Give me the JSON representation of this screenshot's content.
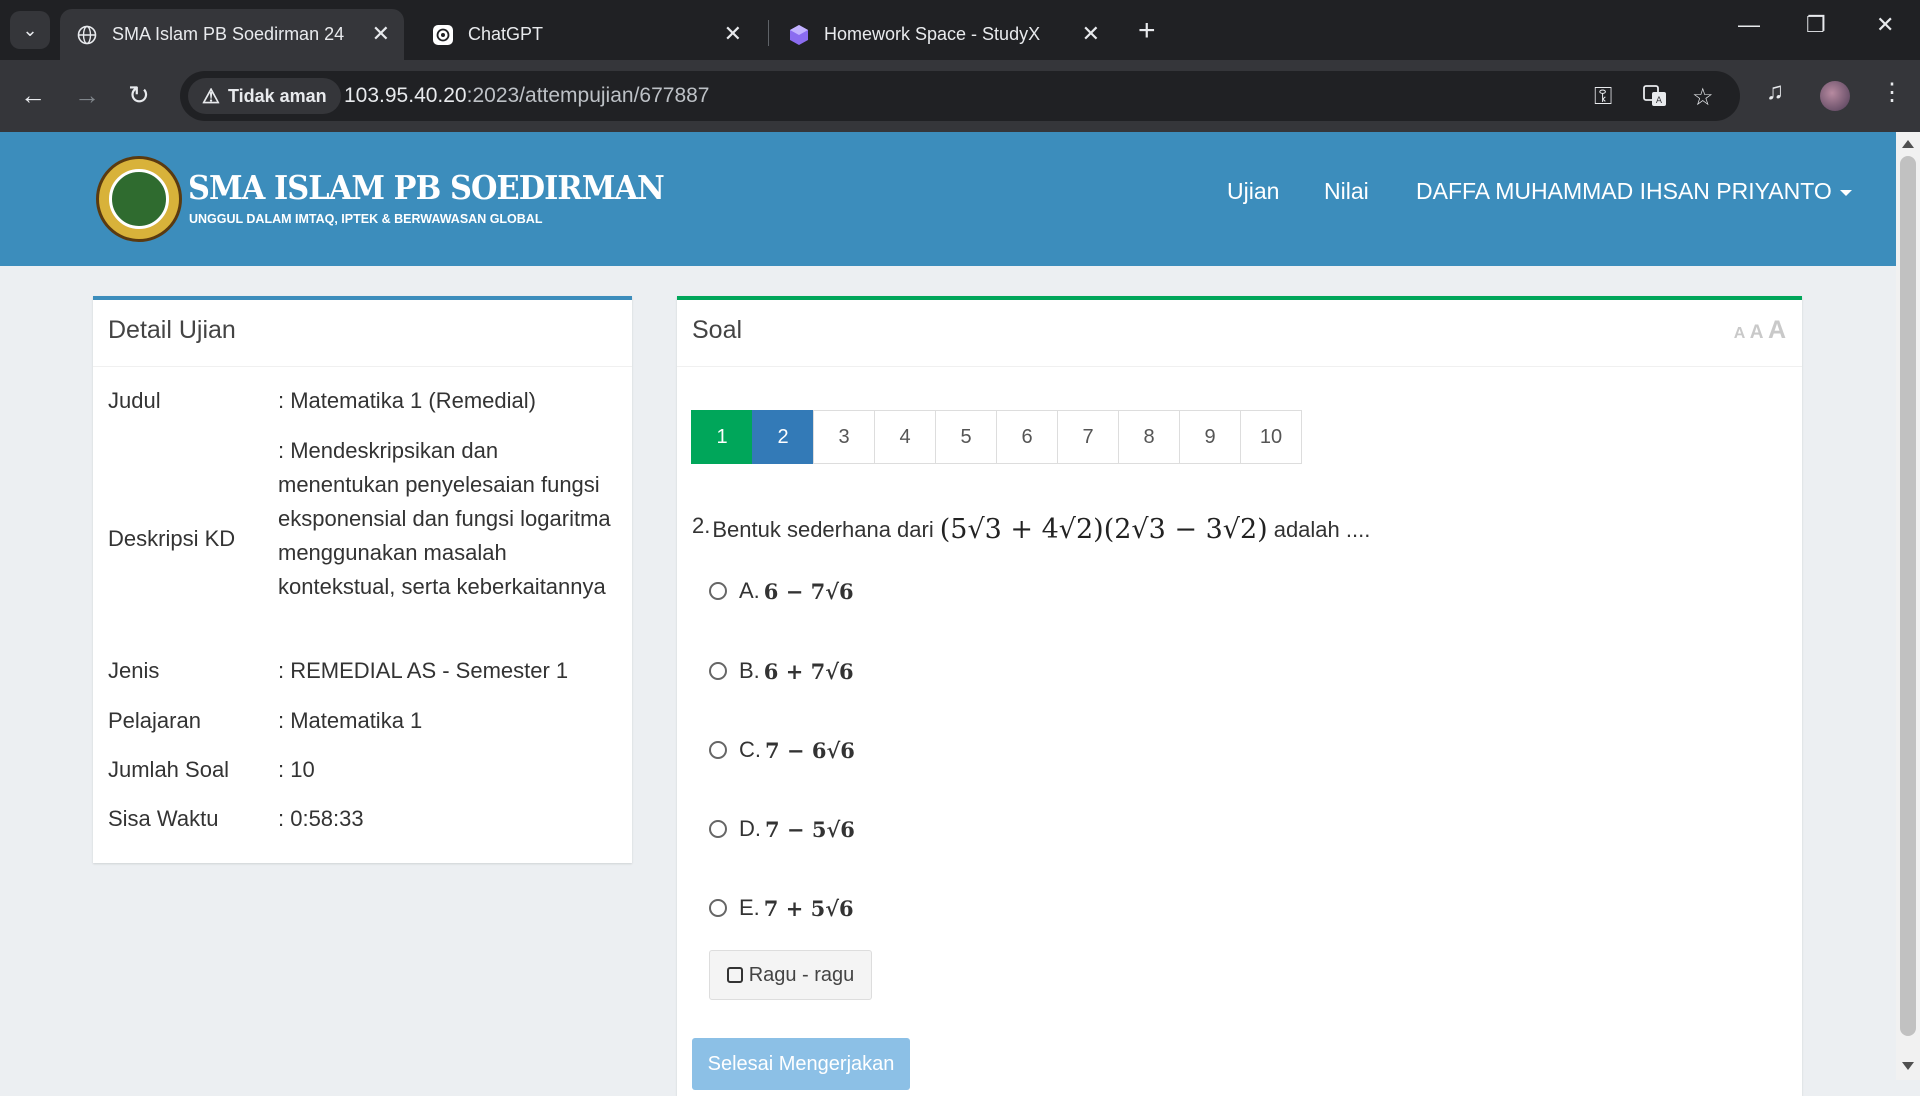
{
  "browser": {
    "tabs": [
      {
        "title": "SMA Islam PB Soedirman 24",
        "icon": "globe-icon",
        "active": true
      },
      {
        "title": "ChatGPT",
        "icon": "chatgpt-icon",
        "active": false
      },
      {
        "title": "Homework Space - StudyX",
        "icon": "studyx-icon",
        "active": false
      }
    ],
    "security_label": "Tidak aman",
    "url_host": "103.95.40.20",
    "url_path": ":2023/attempujian/677887"
  },
  "header": {
    "logo_title": "SMA ISLAM PB SOEDIRMAN",
    "logo_subtitle": "UNGGUL DALAM IMTAQ, IPTEK & BERWAWASAN GLOBAL",
    "nav": {
      "exam": "Ujian",
      "grades": "Nilai",
      "user": "DAFFA MUHAMMAD IHSAN PRIYANTO"
    },
    "color": "#3c8dbc"
  },
  "detail": {
    "title": "Detail Ujian",
    "rows": [
      {
        "label": "Judul",
        "value": ": Matematika 1 (Remedial)"
      },
      {
        "label": "Deskripsi KD",
        "value": ": Mendeskripsikan dan menentukan penyelesaian fungsi eksponensial dan fungsi logaritma menggunakan masalah kontekstual, serta keberkaitannya"
      },
      {
        "label": "Jenis",
        "value": ": REMEDIAL AS - Semester 1"
      },
      {
        "label": "Pelajaran",
        "value": ": Matematika 1"
      },
      {
        "label": "Jumlah Soal",
        "value": ": 10"
      },
      {
        "label": "Sisa Waktu",
        "value": ": 0:58:33"
      }
    ]
  },
  "question_panel": {
    "title": "Soal",
    "font_controls": [
      "A",
      "A",
      "A"
    ],
    "pages": [
      "1",
      "2",
      "3",
      "4",
      "5",
      "6",
      "7",
      "8",
      "9",
      "10"
    ],
    "answered_page": "1",
    "current_page": "2",
    "number": "2.",
    "text_before": "Bentuk sederhana dari",
    "expression": "(5√3 + 4√2)(2√3 − 3√2)",
    "text_after": "adalah ....",
    "options": [
      {
        "letter": "A.",
        "value": "6 − 7√6"
      },
      {
        "letter": "B.",
        "value": "6 + 7√6"
      },
      {
        "letter": "C.",
        "value": "7 − 6√6"
      },
      {
        "letter": "D.",
        "value": "7 − 5√6"
      },
      {
        "letter": "E.",
        "value": "7 + 5√6"
      }
    ],
    "doubt_label": "Ragu - ragu",
    "finish_label": "Selesai Mengerjakan",
    "accent_color": "#00a65a",
    "current_color": "#337ab7"
  }
}
